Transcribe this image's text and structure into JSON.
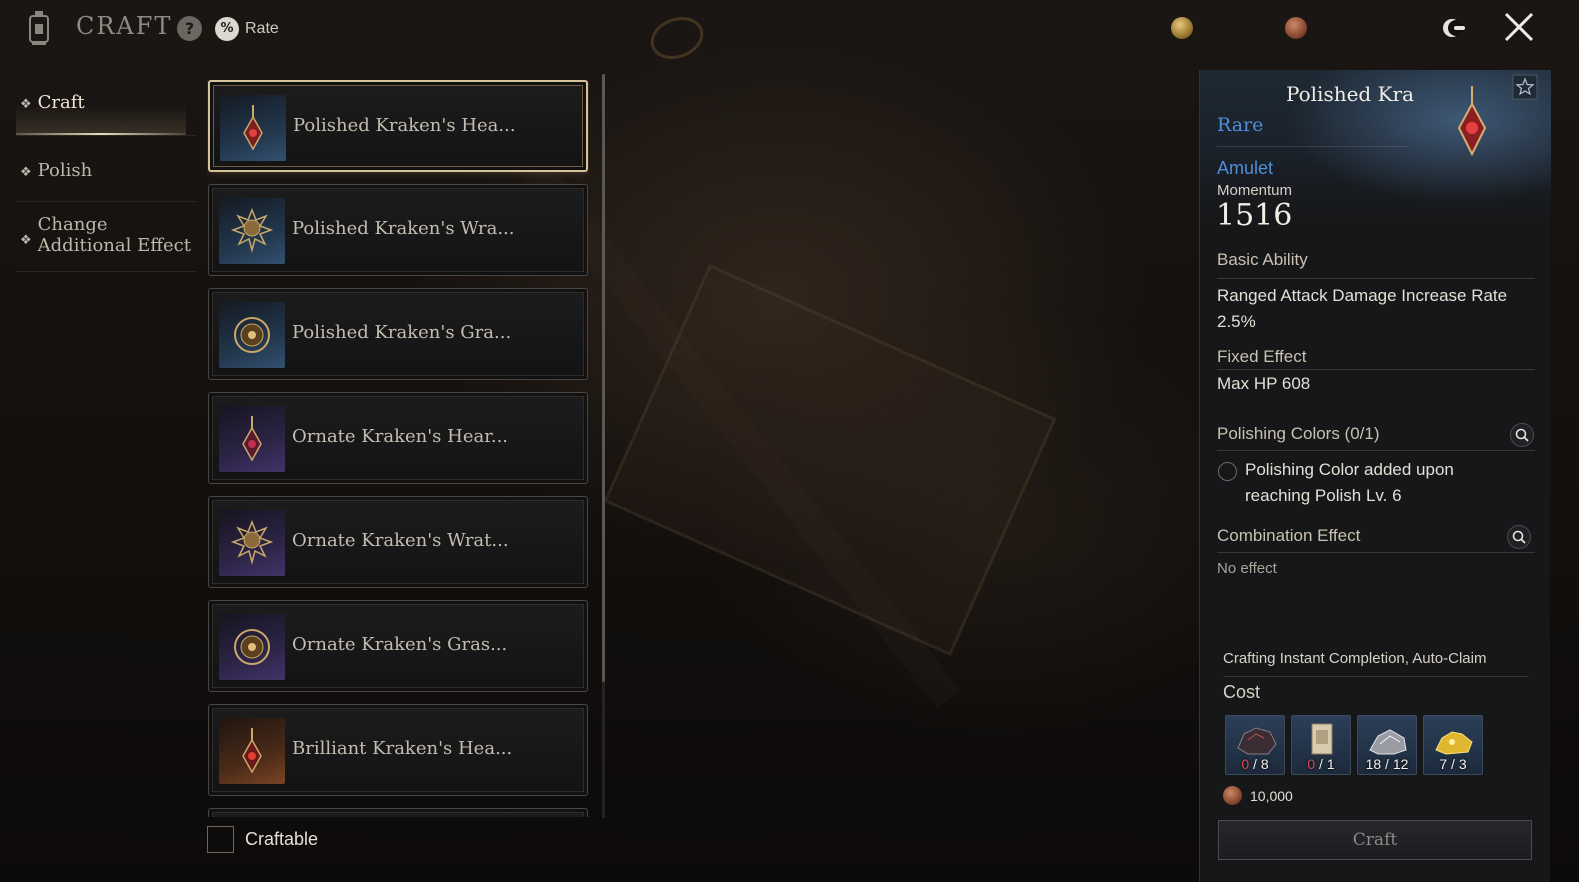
{
  "header": {
    "title": "CRAFT",
    "help_label": "?",
    "rate_icon_text": "%",
    "rate_label": "Rate"
  },
  "icons": {
    "craft_logo": "lantern-icon",
    "currency_1": "gold-coin-icon",
    "currency_2": "copper-coin-icon",
    "toggle": "moon-toggle-icon",
    "close": "close-icon"
  },
  "nav": {
    "items": [
      {
        "label": "Craft",
        "active": true
      },
      {
        "label": "Polish",
        "active": false
      },
      {
        "label": "Change Additional Effect",
        "active": false
      }
    ]
  },
  "list": {
    "items": [
      {
        "name": "Polished Kraken's Hea...",
        "icon": "heart-amulet-icon",
        "tone": "blue",
        "selected": true
      },
      {
        "name": "Polished Kraken's Wra...",
        "icon": "wrath-amulet-icon",
        "tone": "blue",
        "selected": false
      },
      {
        "name": "Polished Kraken's Gra...",
        "icon": "grasp-amulet-icon",
        "tone": "blue",
        "selected": false
      },
      {
        "name": "Ornate Kraken's Hear...",
        "icon": "heart-amulet-icon",
        "tone": "purple",
        "selected": false
      },
      {
        "name": "Ornate Kraken's Wrat...",
        "icon": "wrath-amulet-icon",
        "tone": "purple",
        "selected": false
      },
      {
        "name": "Ornate Kraken's Gras...",
        "icon": "grasp-amulet-icon",
        "tone": "purple",
        "selected": false
      },
      {
        "name": "Brilliant Kraken's Hea...",
        "icon": "heart-amulet-icon",
        "tone": "orange",
        "selected": false
      }
    ],
    "filter_label": "Craftable",
    "filter_checked": false
  },
  "detail": {
    "title": "Polished Kra",
    "rarity": "Rare",
    "slot": "Amulet",
    "stat_label": "Momentum",
    "stat_value": "1516",
    "basic_ability": {
      "title": "Basic Ability",
      "text": "Ranged Attack Damage Increase Rate 2.5%"
    },
    "fixed_effect": {
      "title": "Fixed Effect",
      "text": "Max HP 608"
    },
    "polishing_colors": {
      "title": "Polishing Colors (0/1)",
      "text": "Polishing Color added upon reaching Polish Lv. 6"
    },
    "combination_effect": {
      "title": "Combination Effect",
      "text": "No effect"
    },
    "instant_label": "Crafting Instant Completion, Auto-Claim",
    "cost_label": "Cost",
    "materials": [
      {
        "icon": "dark-ore-icon",
        "have": "0",
        "need": "8",
        "short": true
      },
      {
        "icon": "scroll-icon",
        "have": "0",
        "need": "1",
        "short": true
      },
      {
        "icon": "silver-ore-icon",
        "have": "18",
        "need": "12",
        "short": false
      },
      {
        "icon": "gold-ore-icon",
        "have": "7",
        "need": "3",
        "short": false
      }
    ],
    "gold_cost": "10,000",
    "craft_button": "Craft"
  },
  "colors": {
    "rarity_blue": "#4f8ed8",
    "shortage_red": "#e0474a",
    "selected_border": "#d7c39a"
  }
}
